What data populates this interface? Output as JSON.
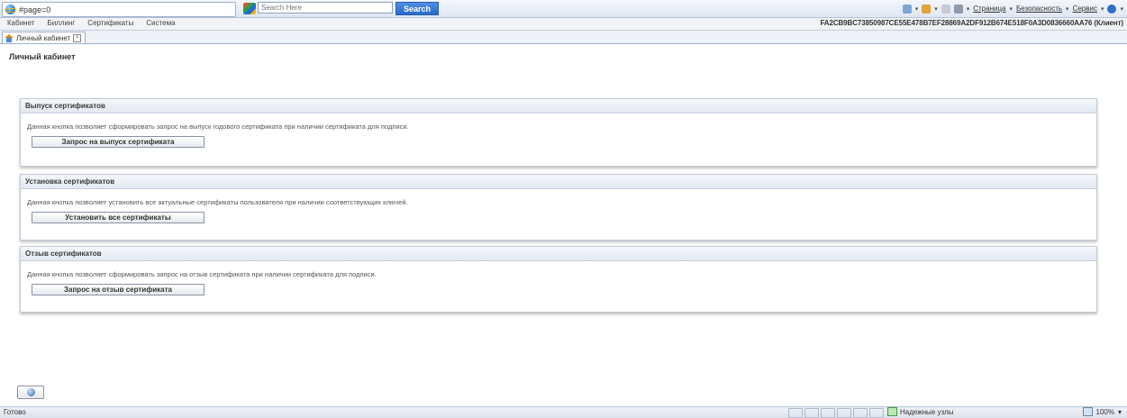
{
  "browser": {
    "tab_title": "#page=0",
    "search_placeholder": "Search Here",
    "search_button": "Search",
    "commands": {
      "page": "Страница",
      "security": "Безопасность",
      "service": "Сервис"
    }
  },
  "menu": {
    "items": [
      "Кабинет",
      "Биллинг",
      "Сертификаты",
      "Система"
    ],
    "cert_id": "FA2CB9BC73850987CE55E478B7EF28869A2DF912B674E518F0A3D0836660AA76 (Клиент)"
  },
  "app_tab": {
    "label": "Личный кабинет"
  },
  "page": {
    "heading": "Личный кабинет"
  },
  "panels": {
    "issue": {
      "title": "Выпуск сертификатов",
      "description": "Данная кнопка позволяет сформировать запрос на выпуск годового сертификата при наличии сертификата для подписи.",
      "button": "Запрос на выпуск сертификата"
    },
    "install": {
      "title": "Установка сертификатов",
      "description": "Данная кнопка позволяет установить все актуальные сертификаты пользователя при наличии соответствующих ключей.",
      "button": "Установить все сертификаты"
    },
    "revoke": {
      "title": "Отзыв сертификатов",
      "description": "Данная кнопка позволяет сформировать запрос на отзыв сертификата при наличии сертификата для подписи.",
      "button": "Запрос на отзыв сертификата"
    }
  },
  "status": {
    "text": "Готово",
    "zone": "Надежные узлы",
    "zoom": "100%"
  },
  "colors": {
    "search_button": "#2a69c7",
    "panel_header": "#e3e9f2"
  },
  "icons": [
    "ie-logo-icon",
    "search-engine-icon",
    "home-icon",
    "tab-close-icon",
    "help-icon",
    "trusted-zone-icon",
    "zoom-icon"
  ]
}
